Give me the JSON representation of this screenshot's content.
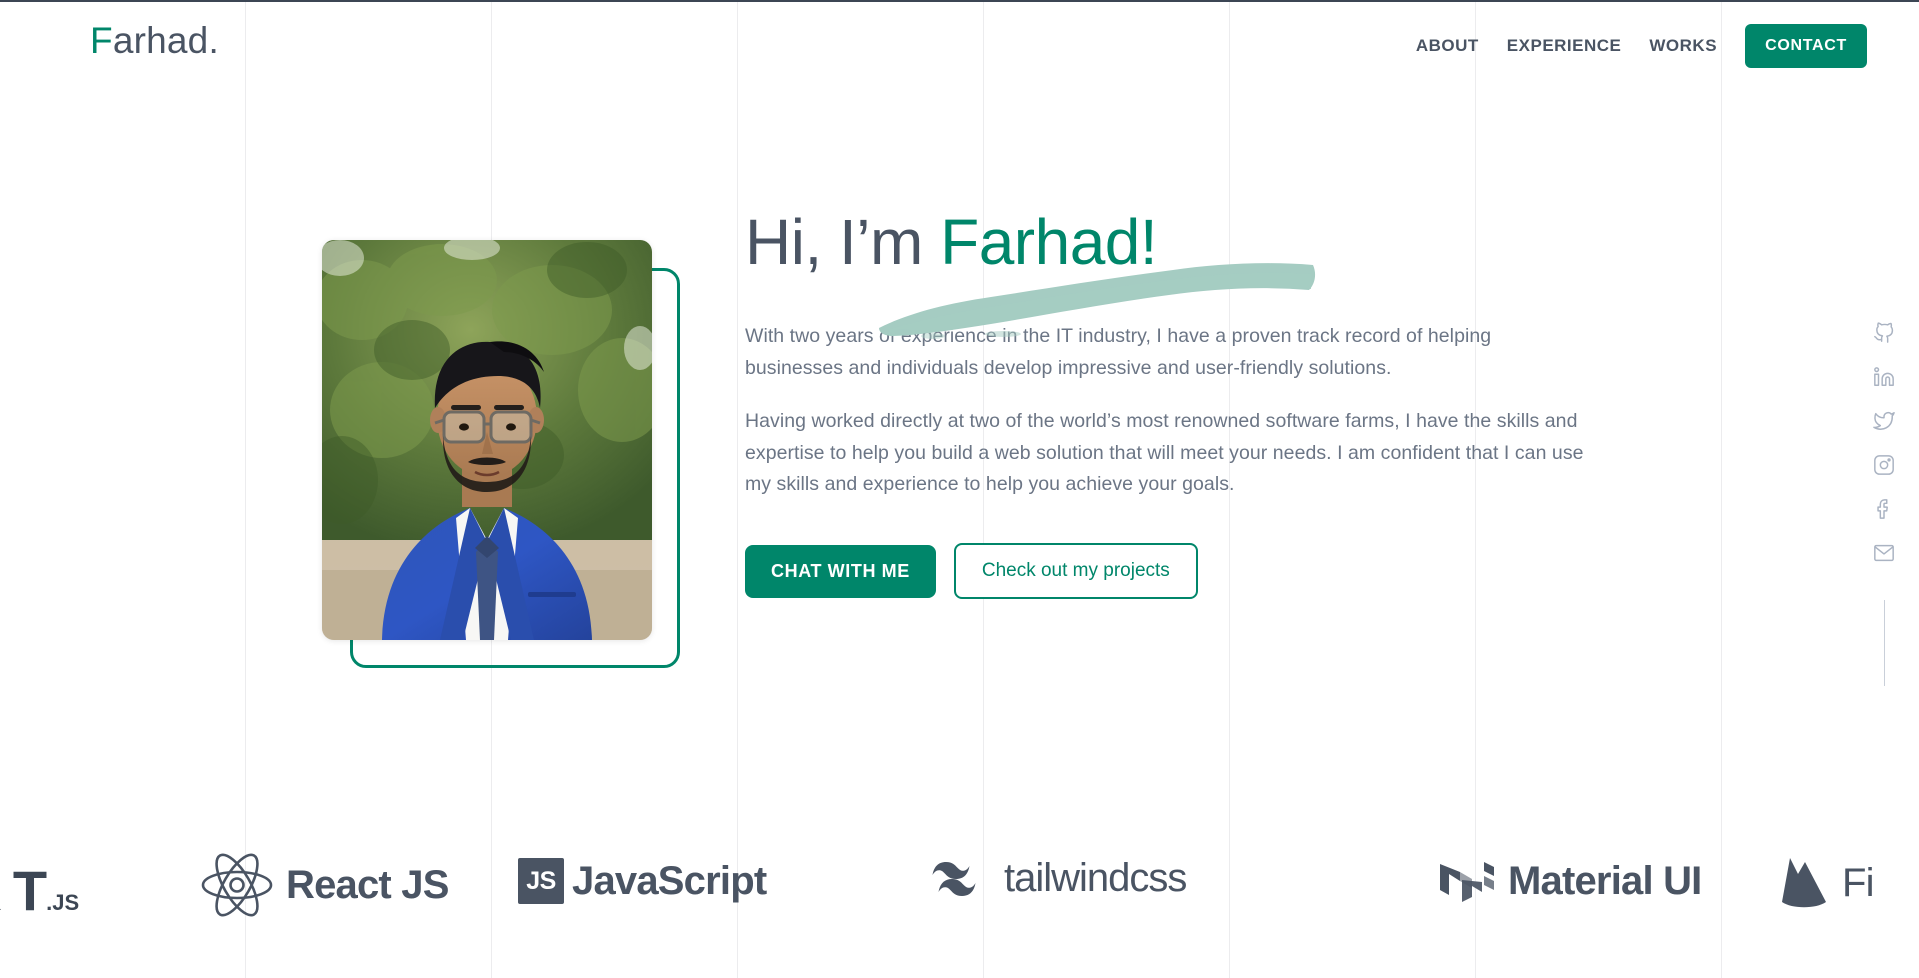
{
  "header": {
    "logo_accent": "F",
    "logo_rest": "arhad.",
    "nav": [
      {
        "label": "ABOUT",
        "name": "nav-link-about"
      },
      {
        "label": "EXPERIENCE",
        "name": "nav-link-experience"
      },
      {
        "label": "WORKS",
        "name": "nav-link-works"
      }
    ],
    "cta_label": "CONTACT"
  },
  "hero": {
    "title_plain": "Hi, I’m ",
    "title_accent": "Farhad!",
    "paragraph_1": "With two years of experience in the IT industry, I have a proven track record of helping businesses and individuals develop impressive and user-friendly solutions.",
    "paragraph_2": "Having worked directly at two of the world’s most renowned software farms, I have the skills and expertise to help you build a web solution that will meet your needs. I am confident that I can use my skills and experience to help you achieve your goals.",
    "primary_cta": "CHAT WITH ME",
    "secondary_cta": "Check out my projects",
    "photo_alt": "portrait-photo"
  },
  "social": [
    {
      "name": "github-icon",
      "label": "GitHub"
    },
    {
      "name": "linkedin-icon",
      "label": "LinkedIn"
    },
    {
      "name": "twitter-icon",
      "label": "Twitter"
    },
    {
      "name": "instagram-icon",
      "label": "Instagram"
    },
    {
      "name": "facebook-icon",
      "label": "Facebook"
    },
    {
      "name": "email-icon",
      "label": "Email"
    }
  ],
  "tech": [
    {
      "label": ".JS",
      "prefix": "X T",
      "name": "tech-nextjs"
    },
    {
      "label": "React JS",
      "name": "tech-reactjs"
    },
    {
      "label": "JavaScript",
      "badge": "JS",
      "name": "tech-javascript"
    },
    {
      "label": "tailwindcss",
      "name": "tech-tailwindcss"
    },
    {
      "label": "Material UI",
      "name": "tech-materialui"
    },
    {
      "label": "Fi",
      "name": "tech-firebase"
    }
  ],
  "colors": {
    "accent": "#00866a",
    "text_dark": "#4a5463",
    "text_body": "#6b7585",
    "brush": "#a5ccc2",
    "grid_line": "#ececee",
    "icon_muted": "#aab3c2"
  }
}
